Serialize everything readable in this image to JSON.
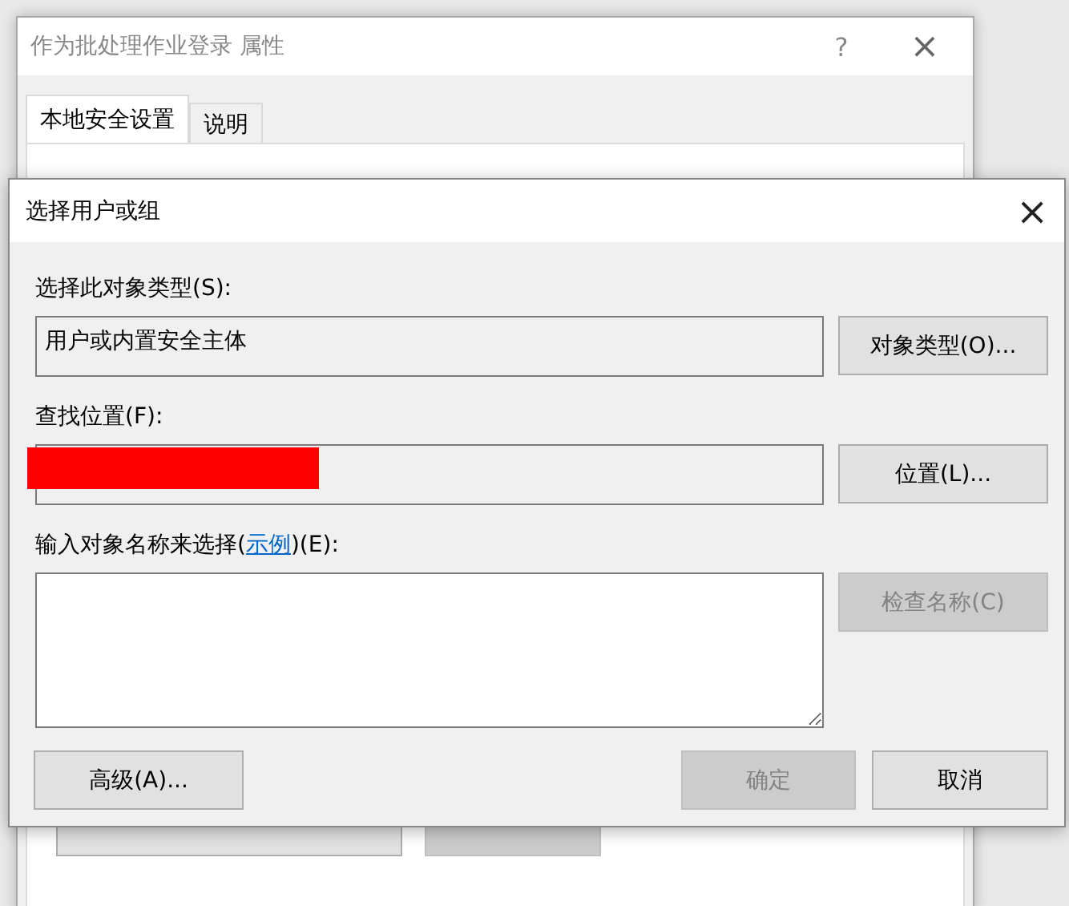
{
  "back_window": {
    "title": "作为批处理作业登录 属性",
    "help": "?",
    "close": "×",
    "tabs": [
      {
        "label": "本地安全设置",
        "selected": true
      },
      {
        "label": "说明",
        "selected": false
      }
    ]
  },
  "dialog": {
    "title": "选择用户或组",
    "close": "×",
    "object_type": {
      "label": "选择此对象类型(S):",
      "value": "用户或内置安全主体",
      "button": "对象类型(O)..."
    },
    "location": {
      "label": "查找位置(F):",
      "button": "位置(L)...",
      "redacted": true
    },
    "names": {
      "label_before": "输入对象名称来选择(",
      "link": "示例",
      "label_after": ")(E):",
      "check_button": {
        "label": "检查名称(C)",
        "disabled": true
      }
    },
    "buttons": [
      {
        "label": "高级(A)...",
        "disabled": false
      },
      {
        "label": "确定",
        "disabled": true
      },
      {
        "label": "取消",
        "disabled": false
      }
    ]
  }
}
